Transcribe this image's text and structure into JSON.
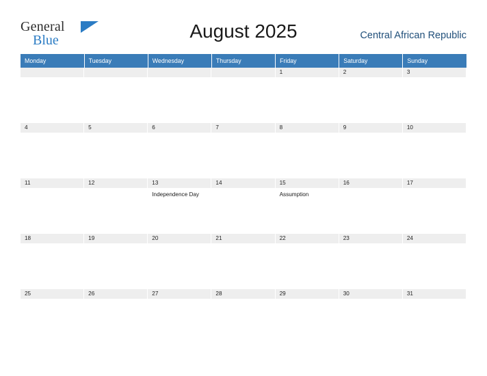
{
  "brand": {
    "name_part1": "General",
    "name_part2": "Blue",
    "flag_icon": "flag-triangle-icon"
  },
  "header": {
    "title": "August 2025",
    "country": "Central African Republic"
  },
  "calendar": {
    "weekday_headers": [
      "Monday",
      "Tuesday",
      "Wednesday",
      "Thursday",
      "Friday",
      "Saturday",
      "Sunday"
    ],
    "colors": {
      "header_bg": "#3a7cb8",
      "header_text": "#ffffff",
      "daynum_bg": "#eeeeee",
      "country_text": "#1f4e79",
      "brand_blue": "#2b7cc4"
    },
    "weeks": [
      [
        {
          "day": "",
          "event": ""
        },
        {
          "day": "",
          "event": ""
        },
        {
          "day": "",
          "event": ""
        },
        {
          "day": "",
          "event": ""
        },
        {
          "day": "1",
          "event": ""
        },
        {
          "day": "2",
          "event": ""
        },
        {
          "day": "3",
          "event": ""
        }
      ],
      [
        {
          "day": "4",
          "event": ""
        },
        {
          "day": "5",
          "event": ""
        },
        {
          "day": "6",
          "event": ""
        },
        {
          "day": "7",
          "event": ""
        },
        {
          "day": "8",
          "event": ""
        },
        {
          "day": "9",
          "event": ""
        },
        {
          "day": "10",
          "event": ""
        }
      ],
      [
        {
          "day": "11",
          "event": ""
        },
        {
          "day": "12",
          "event": ""
        },
        {
          "day": "13",
          "event": "Independence Day"
        },
        {
          "day": "14",
          "event": ""
        },
        {
          "day": "15",
          "event": "Assumption"
        },
        {
          "day": "16",
          "event": ""
        },
        {
          "day": "17",
          "event": ""
        }
      ],
      [
        {
          "day": "18",
          "event": ""
        },
        {
          "day": "19",
          "event": ""
        },
        {
          "day": "20",
          "event": ""
        },
        {
          "day": "21",
          "event": ""
        },
        {
          "day": "22",
          "event": ""
        },
        {
          "day": "23",
          "event": ""
        },
        {
          "day": "24",
          "event": ""
        }
      ],
      [
        {
          "day": "25",
          "event": ""
        },
        {
          "day": "26",
          "event": ""
        },
        {
          "day": "27",
          "event": ""
        },
        {
          "day": "28",
          "event": ""
        },
        {
          "day": "29",
          "event": ""
        },
        {
          "day": "30",
          "event": ""
        },
        {
          "day": "31",
          "event": ""
        }
      ]
    ]
  }
}
